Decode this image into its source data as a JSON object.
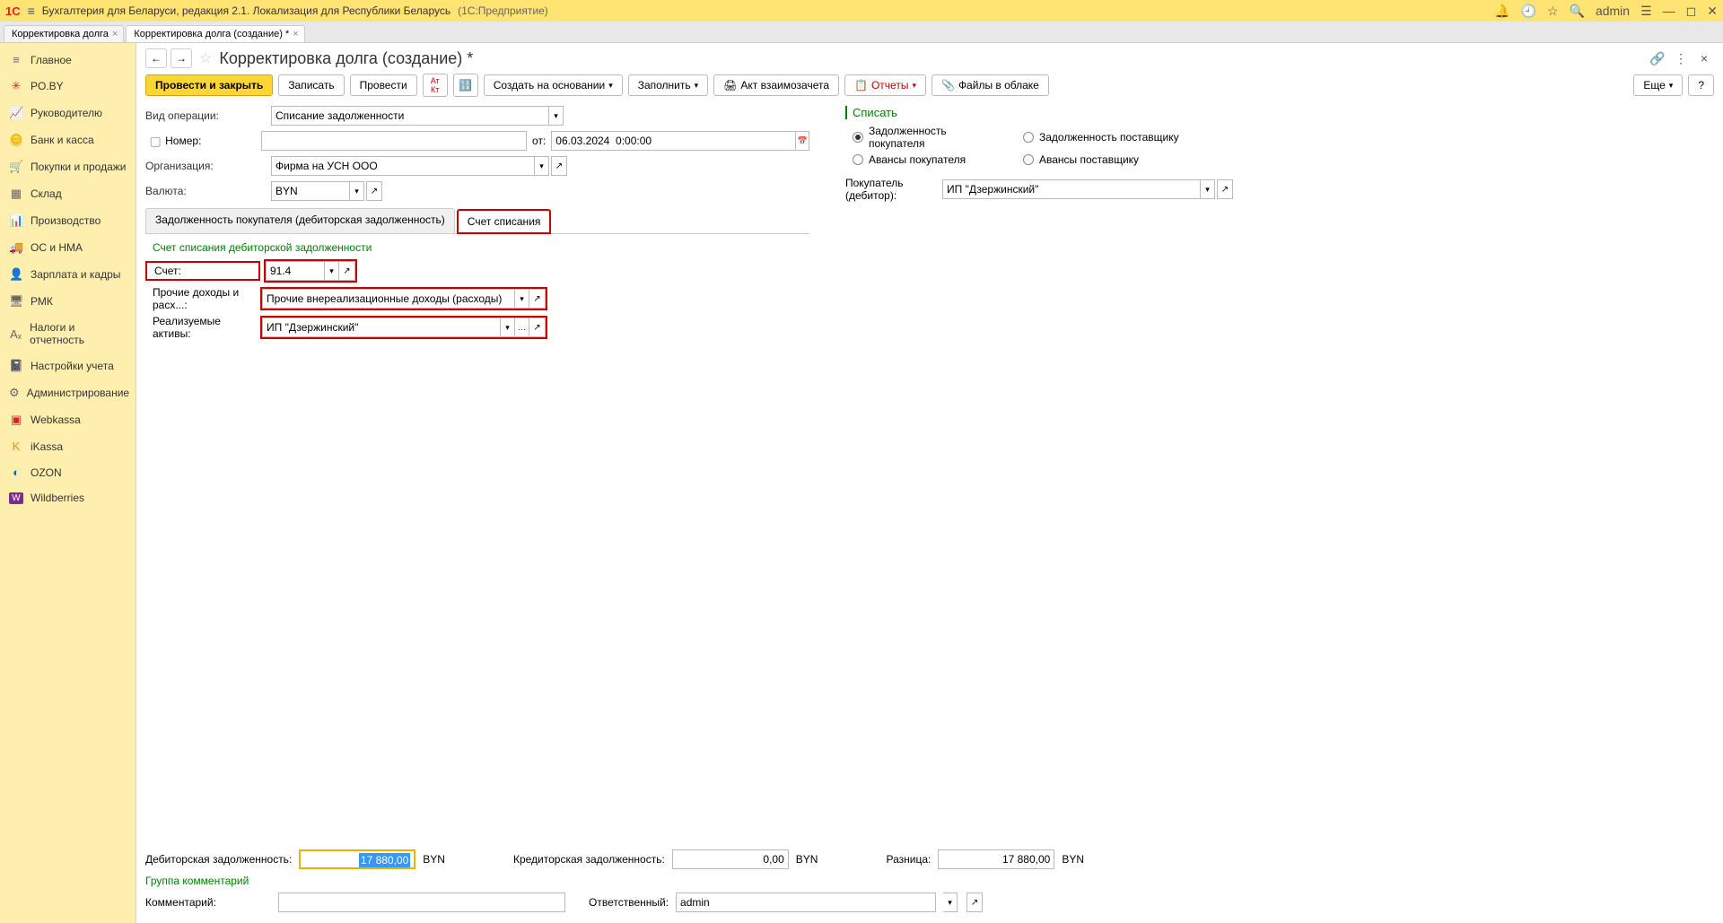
{
  "titlebar": {
    "logo": "1С",
    "title": "Бухгалтерия для Беларуси, редакция 2.1. Локализация для Республики Беларусь",
    "suffix": "(1С:Предприятие)",
    "admin": "admin"
  },
  "doctabs": [
    {
      "label": "Корректировка долга"
    },
    {
      "label": "Корректировка долга (создание) *"
    }
  ],
  "sidebar": {
    "items": [
      {
        "icon": "≡",
        "label": "Главное"
      },
      {
        "icon": "✳",
        "label": "PO.BY"
      },
      {
        "icon": "📈",
        "label": "Руководителю"
      },
      {
        "icon": "🪙",
        "label": "Банк и касса"
      },
      {
        "icon": "🛒",
        "label": "Покупки и продажи"
      },
      {
        "icon": "▦",
        "label": "Склад"
      },
      {
        "icon": "📊",
        "label": "Производство"
      },
      {
        "icon": "🚚",
        "label": "ОС и НМА"
      },
      {
        "icon": "👤",
        "label": "Зарплата и кадры"
      },
      {
        "icon": "🖥",
        "label": "РМК"
      },
      {
        "icon": "Aₓ",
        "label": "Налоги и отчетность"
      },
      {
        "icon": "📓",
        "label": "Настройки учета"
      },
      {
        "icon": "⚙",
        "label": "Администрирование"
      },
      {
        "icon": "▣",
        "label": "Webkassa"
      },
      {
        "icon": "K",
        "label": "iKassa"
      },
      {
        "icon": "◐",
        "label": "OZON"
      },
      {
        "icon": "W",
        "label": "Wildberries"
      }
    ]
  },
  "header": {
    "title": "Корректировка долга (создание) *"
  },
  "toolbar": {
    "post_close": "Провести и закрыть",
    "save": "Записать",
    "post": "Провести",
    "create_based": "Создать на основании",
    "fill": "Заполнить",
    "act": "Акт взаимозачета",
    "reports": "Отчеты",
    "files": "Файлы в облаке",
    "more": "Еще",
    "help": "?"
  },
  "form": {
    "operation_label": "Вид операции:",
    "operation_value": "Списание задолженности",
    "number_label": "Номер:",
    "number_value": "",
    "from_label": "от:",
    "date_value": "06.03.2024  0:00:00",
    "org_label": "Организация:",
    "org_value": "Фирма на УСН ООО",
    "currency_label": "Валюта:",
    "currency_value": "BYN"
  },
  "writeoff": {
    "group_label": "Списать",
    "options": {
      "buyer_debt": "Задолженность покупателя",
      "supplier_debt": "Задолженность поставщику",
      "buyer_advance": "Авансы покупателя",
      "supplier_advance": "Авансы поставщику"
    },
    "buyer_label": "Покупатель (дебитор):",
    "buyer_value": "ИП \"Дзержинский\""
  },
  "tabs": {
    "tab1": "Задолженность покупателя (дебиторская задолженность)",
    "tab2": "Счет списания"
  },
  "tab_content": {
    "section_title": "Счет списания дебиторской задолженности",
    "account_label": "Счет:",
    "account_value": "91.4",
    "income_label": "Прочие доходы и расх...:",
    "income_value": "Прочие внереализационные доходы (расходы)",
    "assets_label": "Реализуемые активы:",
    "assets_value": "ИП \"Дзержинский\""
  },
  "footer": {
    "debtor_label": "Дебиторская задолженность:",
    "debtor_value": "17 880,00",
    "debtor_cur": "BYN",
    "creditor_label": "Кредиторская задолженность:",
    "creditor_value": "0,00",
    "creditor_cur": "BYN",
    "diff_label": "Разница:",
    "diff_value": "17 880,00",
    "diff_cur": "BYN",
    "comment_group": "Группа комментарий",
    "comment_label": "Комментарий:",
    "comment_value": "",
    "responsible_label": "Ответственный:",
    "responsible_value": "admin"
  }
}
